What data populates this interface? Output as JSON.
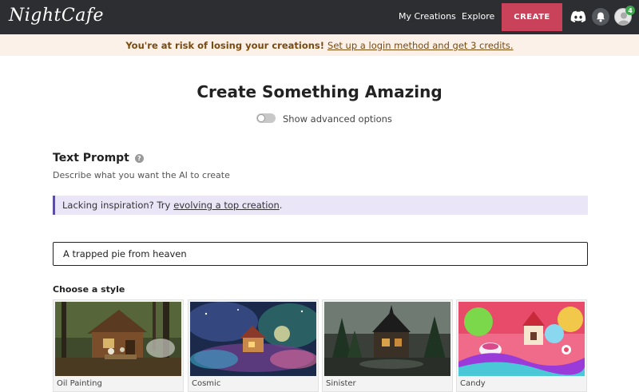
{
  "header": {
    "logo_text": "NightCafe",
    "nav": {
      "my_creations": "My Creations",
      "explore": "Explore"
    },
    "create_label": "CREATE",
    "notification_count": "4",
    "colors": {
      "bar": "#2c2e31",
      "create": "#c9425a",
      "badge": "#3aa84b"
    }
  },
  "banner": {
    "warning": "You're at risk of losing your creations!",
    "link": "Set up a login method and get 3 credits."
  },
  "main": {
    "title": "Create Something Amazing",
    "advanced_toggle_label": "Show advanced options",
    "text_prompt": {
      "title": "Text Prompt",
      "description": "Describe what you want the AI to create",
      "inspiration_prefix": "Lacking inspiration? Try",
      "inspiration_link": "evolving a top creation",
      "inspiration_suffix": ".",
      "prompt_value": "A trapped pie from heaven"
    },
    "styles": {
      "heading": "Choose a style",
      "items": [
        {
          "label": "Oil Painting"
        },
        {
          "label": "Cosmic"
        },
        {
          "label": "Sinister"
        },
        {
          "label": "Candy"
        }
      ]
    }
  }
}
